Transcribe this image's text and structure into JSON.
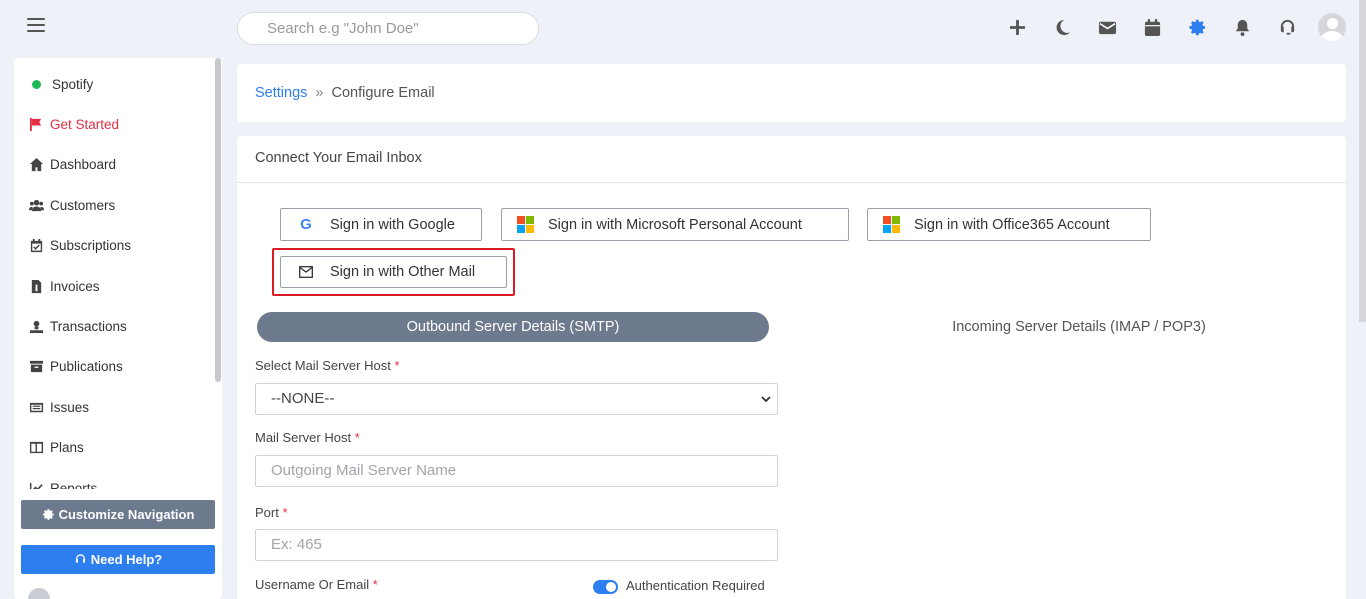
{
  "header": {
    "search_placeholder": "Search e.g \"John Doe\"",
    "icons": [
      "plus-icon",
      "moon-icon",
      "envelope-icon",
      "calendar-icon",
      "gear-icon",
      "bell-icon",
      "headset-icon",
      "user-avatar"
    ],
    "accent_color": "#2d7ff0"
  },
  "sidebar": {
    "items": [
      {
        "label": "Spotify",
        "icon": "spotify-dot"
      },
      {
        "label": "Get Started",
        "icon": "flag-icon"
      },
      {
        "label": "Dashboard",
        "icon": "home-icon"
      },
      {
        "label": "Customers",
        "icon": "users-icon"
      },
      {
        "label": "Subscriptions",
        "icon": "calendar-check-icon"
      },
      {
        "label": "Invoices",
        "icon": "invoice-icon"
      },
      {
        "label": "Transactions",
        "icon": "transactions-icon"
      },
      {
        "label": "Publications",
        "icon": "archive-icon"
      },
      {
        "label": "Issues",
        "icon": "issues-icon"
      },
      {
        "label": "Plans",
        "icon": "plans-icon"
      },
      {
        "label": "Reports",
        "icon": "chart-icon"
      }
    ],
    "customize_label": "Customize Navigation",
    "help_label": "Need Help?"
  },
  "breadcrumb": {
    "parent": "Settings",
    "separator": "»",
    "current": "Configure Email"
  },
  "card": {
    "title": "Connect Your Email Inbox",
    "google_label": "Sign in with Google",
    "microsoft_label": "Sign in with Microsoft Personal Account",
    "office365_label": "Sign in with Office365 Account",
    "other_mail_label": "Sign in with Other Mail",
    "tabs": [
      {
        "label": "Outbound Server Details (SMTP)",
        "active": true
      },
      {
        "label": "Incoming Server Details (IMAP / POP3)",
        "active": false
      }
    ],
    "form": {
      "select_host_label": "Select Mail Server Host",
      "select_host_value": "--NONE--",
      "host_label": "Mail Server Host",
      "host_placeholder": "Outgoing Mail Server Name",
      "port_label": "Port",
      "port_placeholder": "Ex: 465",
      "username_label": "Username Or Email",
      "auth_label": "Authentication Required",
      "required_mark": "*"
    }
  }
}
